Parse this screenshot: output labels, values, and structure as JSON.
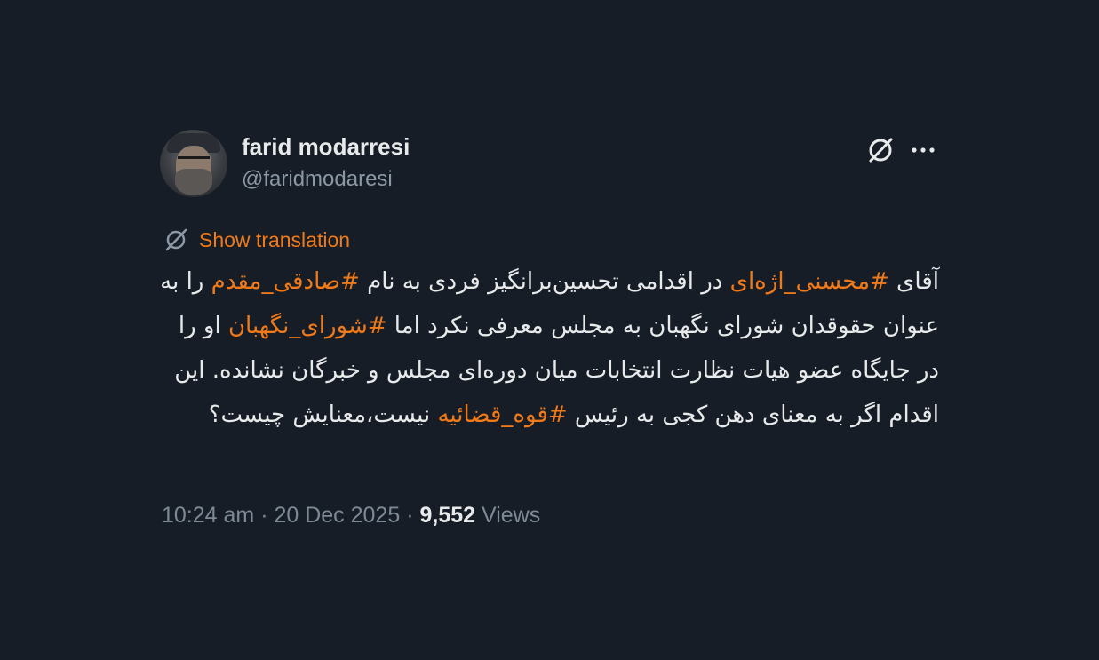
{
  "author": {
    "name": "farid modarresi",
    "handle": "@faridmodaresi"
  },
  "icons": {
    "grok": "grok-icon",
    "more": "more-options-icon",
    "translate": "translate-icon"
  },
  "translate_label": "Show translation",
  "tweet": {
    "l1_a": "آقای ",
    "l1_h": "#محسنی_اژه‌ای",
    "l1_b": " در اقدامی تحسین‌برانگیز فردی به نام ",
    "l2_h": "#صادقی_مقدم",
    "l2_b": " را به عنوان حقوقدان شورای نگهبان به مجلس معرفی نکرد اما ",
    "l3_h": "#شورای_نگهبان",
    "l3_b": " او را در جایگاه عضو هیات نظارت انتخابات میان دوره‌ای مجلس و خبرگان نشانده. این اقدام اگر به معنای دهن کجی به رئیس ",
    "l4_h": "#قوه_قضائیه",
    "l4_b": " نیست،معنایش چیست؟"
  },
  "meta": {
    "time": "10:24 am",
    "date": "20 Dec 2025",
    "sep": " · ",
    "views_count": "9,552",
    "views_label": "Views"
  },
  "colors": {
    "background": "#161d26",
    "accent": "#f07a1a",
    "secondary_text": "#8b98a5"
  }
}
